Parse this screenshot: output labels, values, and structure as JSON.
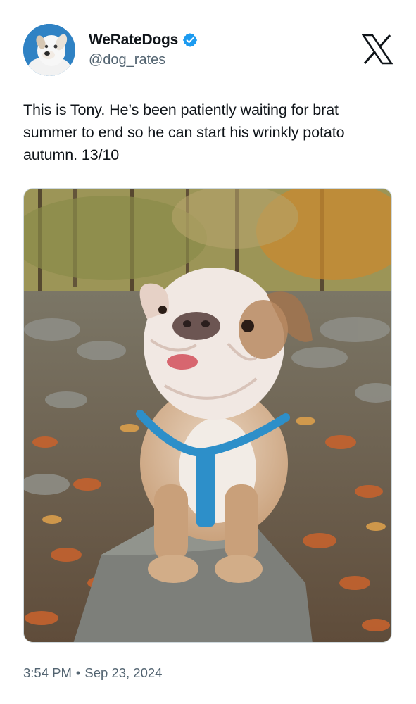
{
  "tweet": {
    "author": {
      "display_name": "WeRateDogs",
      "handle": "@dog_rates",
      "verified": true
    },
    "text": "This is Tony. He’s been patiently waiting for brat summer to end so he can start his wrinkly potato autumn. 13/10",
    "media": {
      "type": "photo",
      "subject": "bulldog"
    },
    "timestamp": {
      "time": "3:54 PM",
      "separator": "•",
      "date": "Sep 23, 2024"
    }
  },
  "icons": {
    "platform_logo": "x-logo-icon",
    "verified": "verified-badge-icon"
  },
  "colors": {
    "text_primary": "#0f1419",
    "text_secondary": "#536471",
    "verified_blue": "#1d9bf0"
  }
}
